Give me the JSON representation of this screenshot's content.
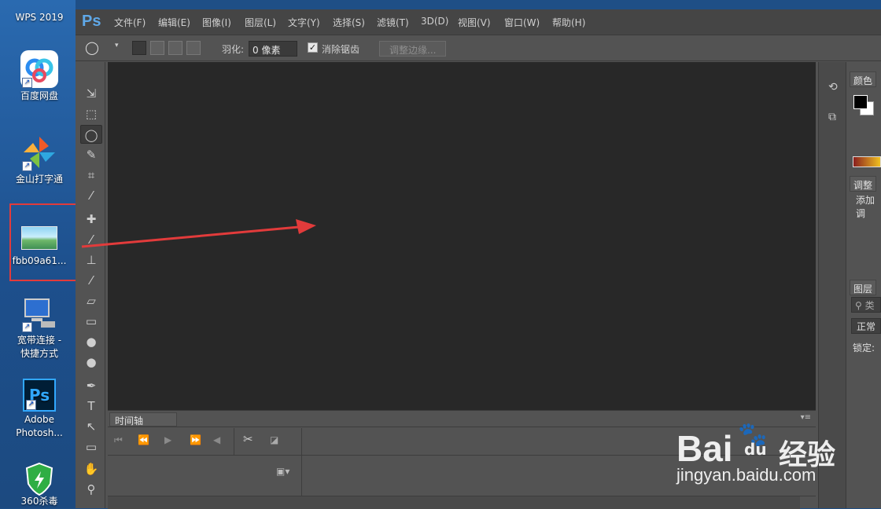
{
  "desktop": {
    "icons": [
      {
        "label": "WPS 2019"
      },
      {
        "label": "百度网盘"
      },
      {
        "label": "金山打字通"
      },
      {
        "label": "fbb09a61..."
      },
      {
        "label": "宽带连接 -\n快捷方式"
      },
      {
        "label": "Adobe\nPhotosh..."
      },
      {
        "label": "360杀毒"
      }
    ],
    "ps_icon_text": "Ps"
  },
  "photoshop": {
    "logo": "Ps",
    "menus": [
      "文件(F)",
      "编辑(E)",
      "图像(I)",
      "图层(L)",
      "文字(Y)",
      "选择(S)",
      "滤镜(T)",
      "3D(D)",
      "视图(V)",
      "窗口(W)",
      "帮助(H)"
    ],
    "options": {
      "feather_label": "羽化:",
      "feather_value": "0 像素",
      "antialias_label": "消除锯齿",
      "antialias_checked": true,
      "refine_edge": "调整边缘..."
    },
    "timeline": {
      "tab": "时间轴"
    },
    "panels": {
      "color_tab": "颜色",
      "adjust_tab": "调整",
      "adjust_text": "添加调",
      "layers_tab": "图层",
      "layers_search": "类",
      "blend_mode": "正常",
      "lock_label": "锁定:"
    }
  },
  "watermark": {
    "brand": "Bai",
    "du": "du",
    "cn": "经验",
    "url": "jingyan.baidu.com"
  },
  "colors": {
    "arrow": "#e23b3b",
    "highlight_box": "#e23b3b",
    "canvas": "#282828"
  }
}
